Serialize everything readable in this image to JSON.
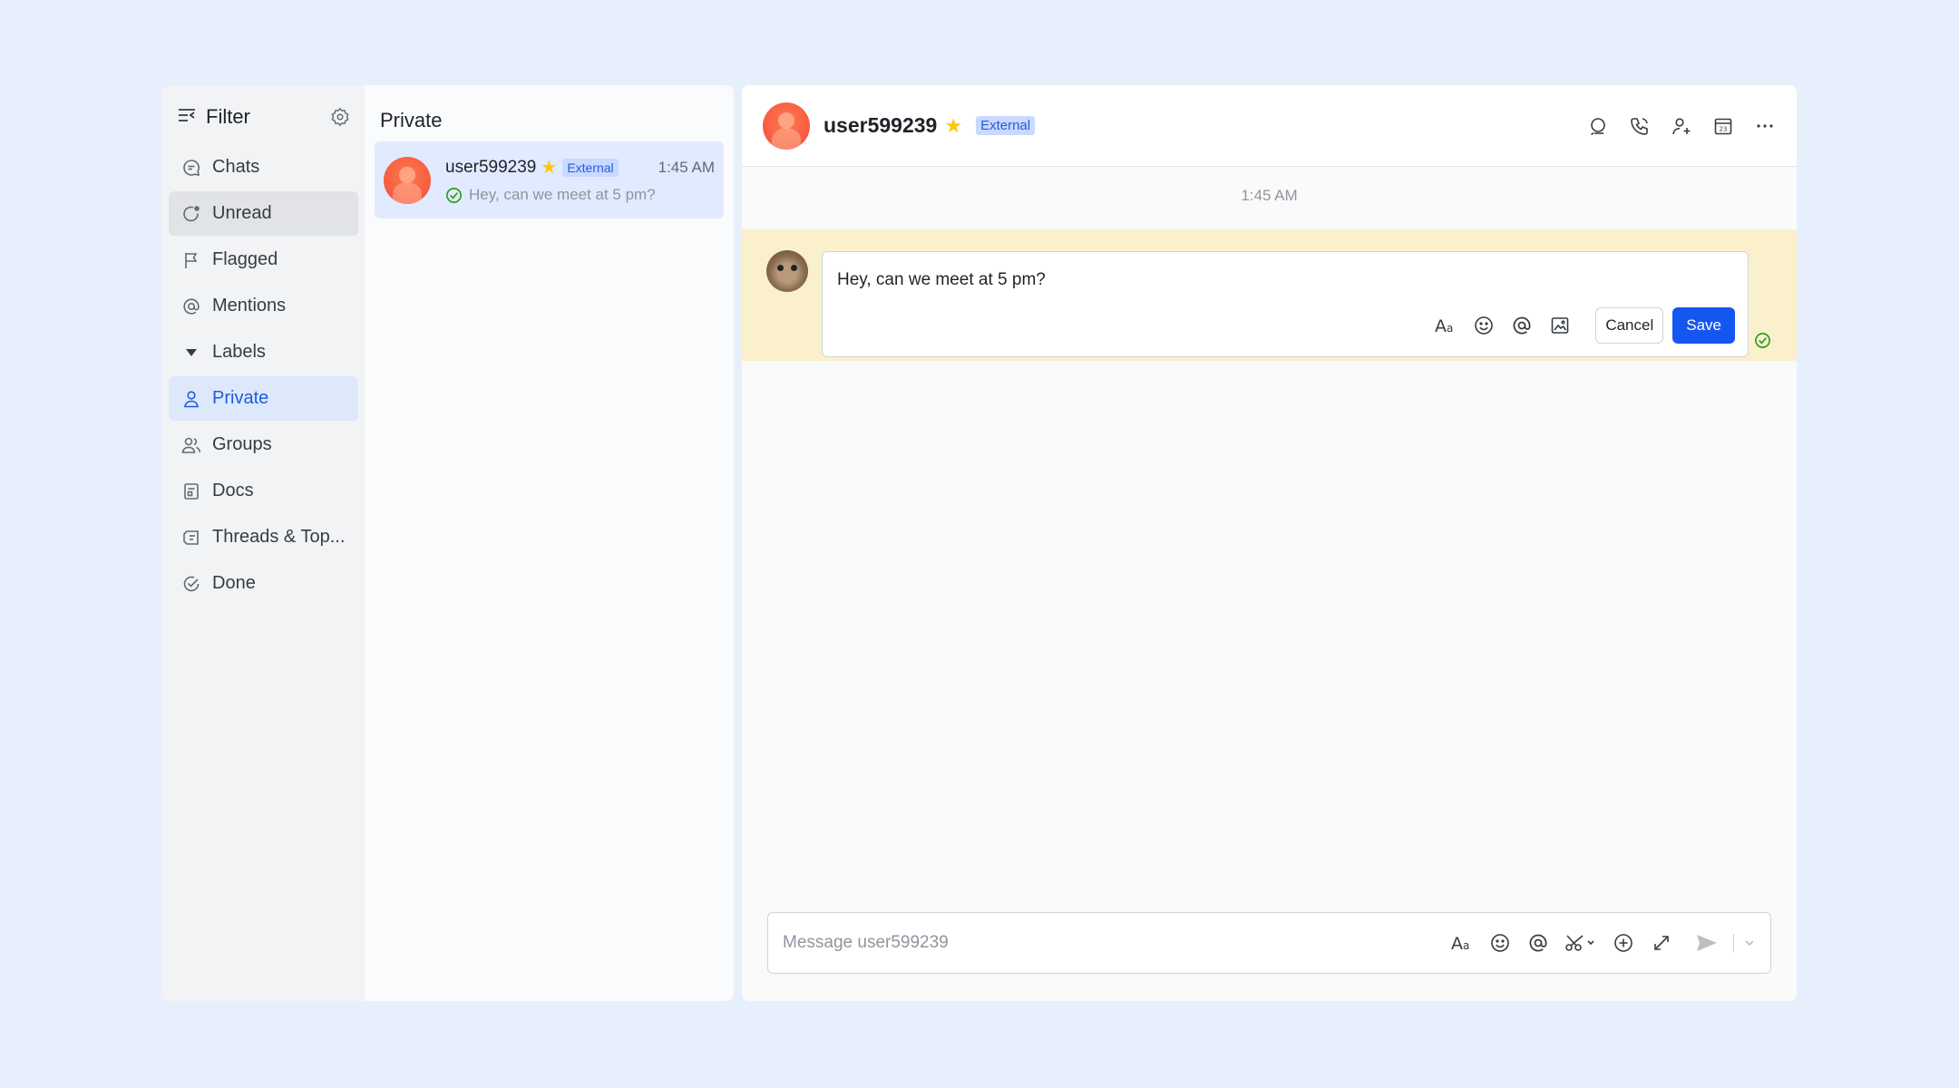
{
  "nav": {
    "title": "Filter",
    "items": [
      {
        "label": "Chats",
        "icon": "chat-bubble-icon"
      },
      {
        "label": "Unread",
        "icon": "unread-icon"
      },
      {
        "label": "Flagged",
        "icon": "flag-icon"
      },
      {
        "label": "Mentions",
        "icon": "at-icon"
      },
      {
        "label": "Labels",
        "icon": "caret-down-icon"
      },
      {
        "label": "Private",
        "icon": "person-icon"
      },
      {
        "label": "Groups",
        "icon": "group-icon"
      },
      {
        "label": "Docs",
        "icon": "doc-icon"
      },
      {
        "label": "Threads & Top...",
        "icon": "thread-icon"
      },
      {
        "label": "Done",
        "icon": "check-circle-icon"
      }
    ]
  },
  "list": {
    "title": "Private",
    "chats": [
      {
        "name": "user599239",
        "badge": "External",
        "time": "1:45 AM",
        "preview": "Hey, can we meet at 5 pm?"
      }
    ]
  },
  "conversation": {
    "name": "user599239",
    "badge": "External",
    "time_separator": "1:45 AM",
    "editing_message": "Hey, can we meet at 5 pm?",
    "cancel_label": "Cancel",
    "save_label": "Save",
    "composer_placeholder": "Message user599239"
  },
  "colors": {
    "accent": "#1456f0",
    "active_nav_bg": "#dde8fb",
    "highlight_row": "#faf1cc",
    "star": "#ffc60a"
  }
}
